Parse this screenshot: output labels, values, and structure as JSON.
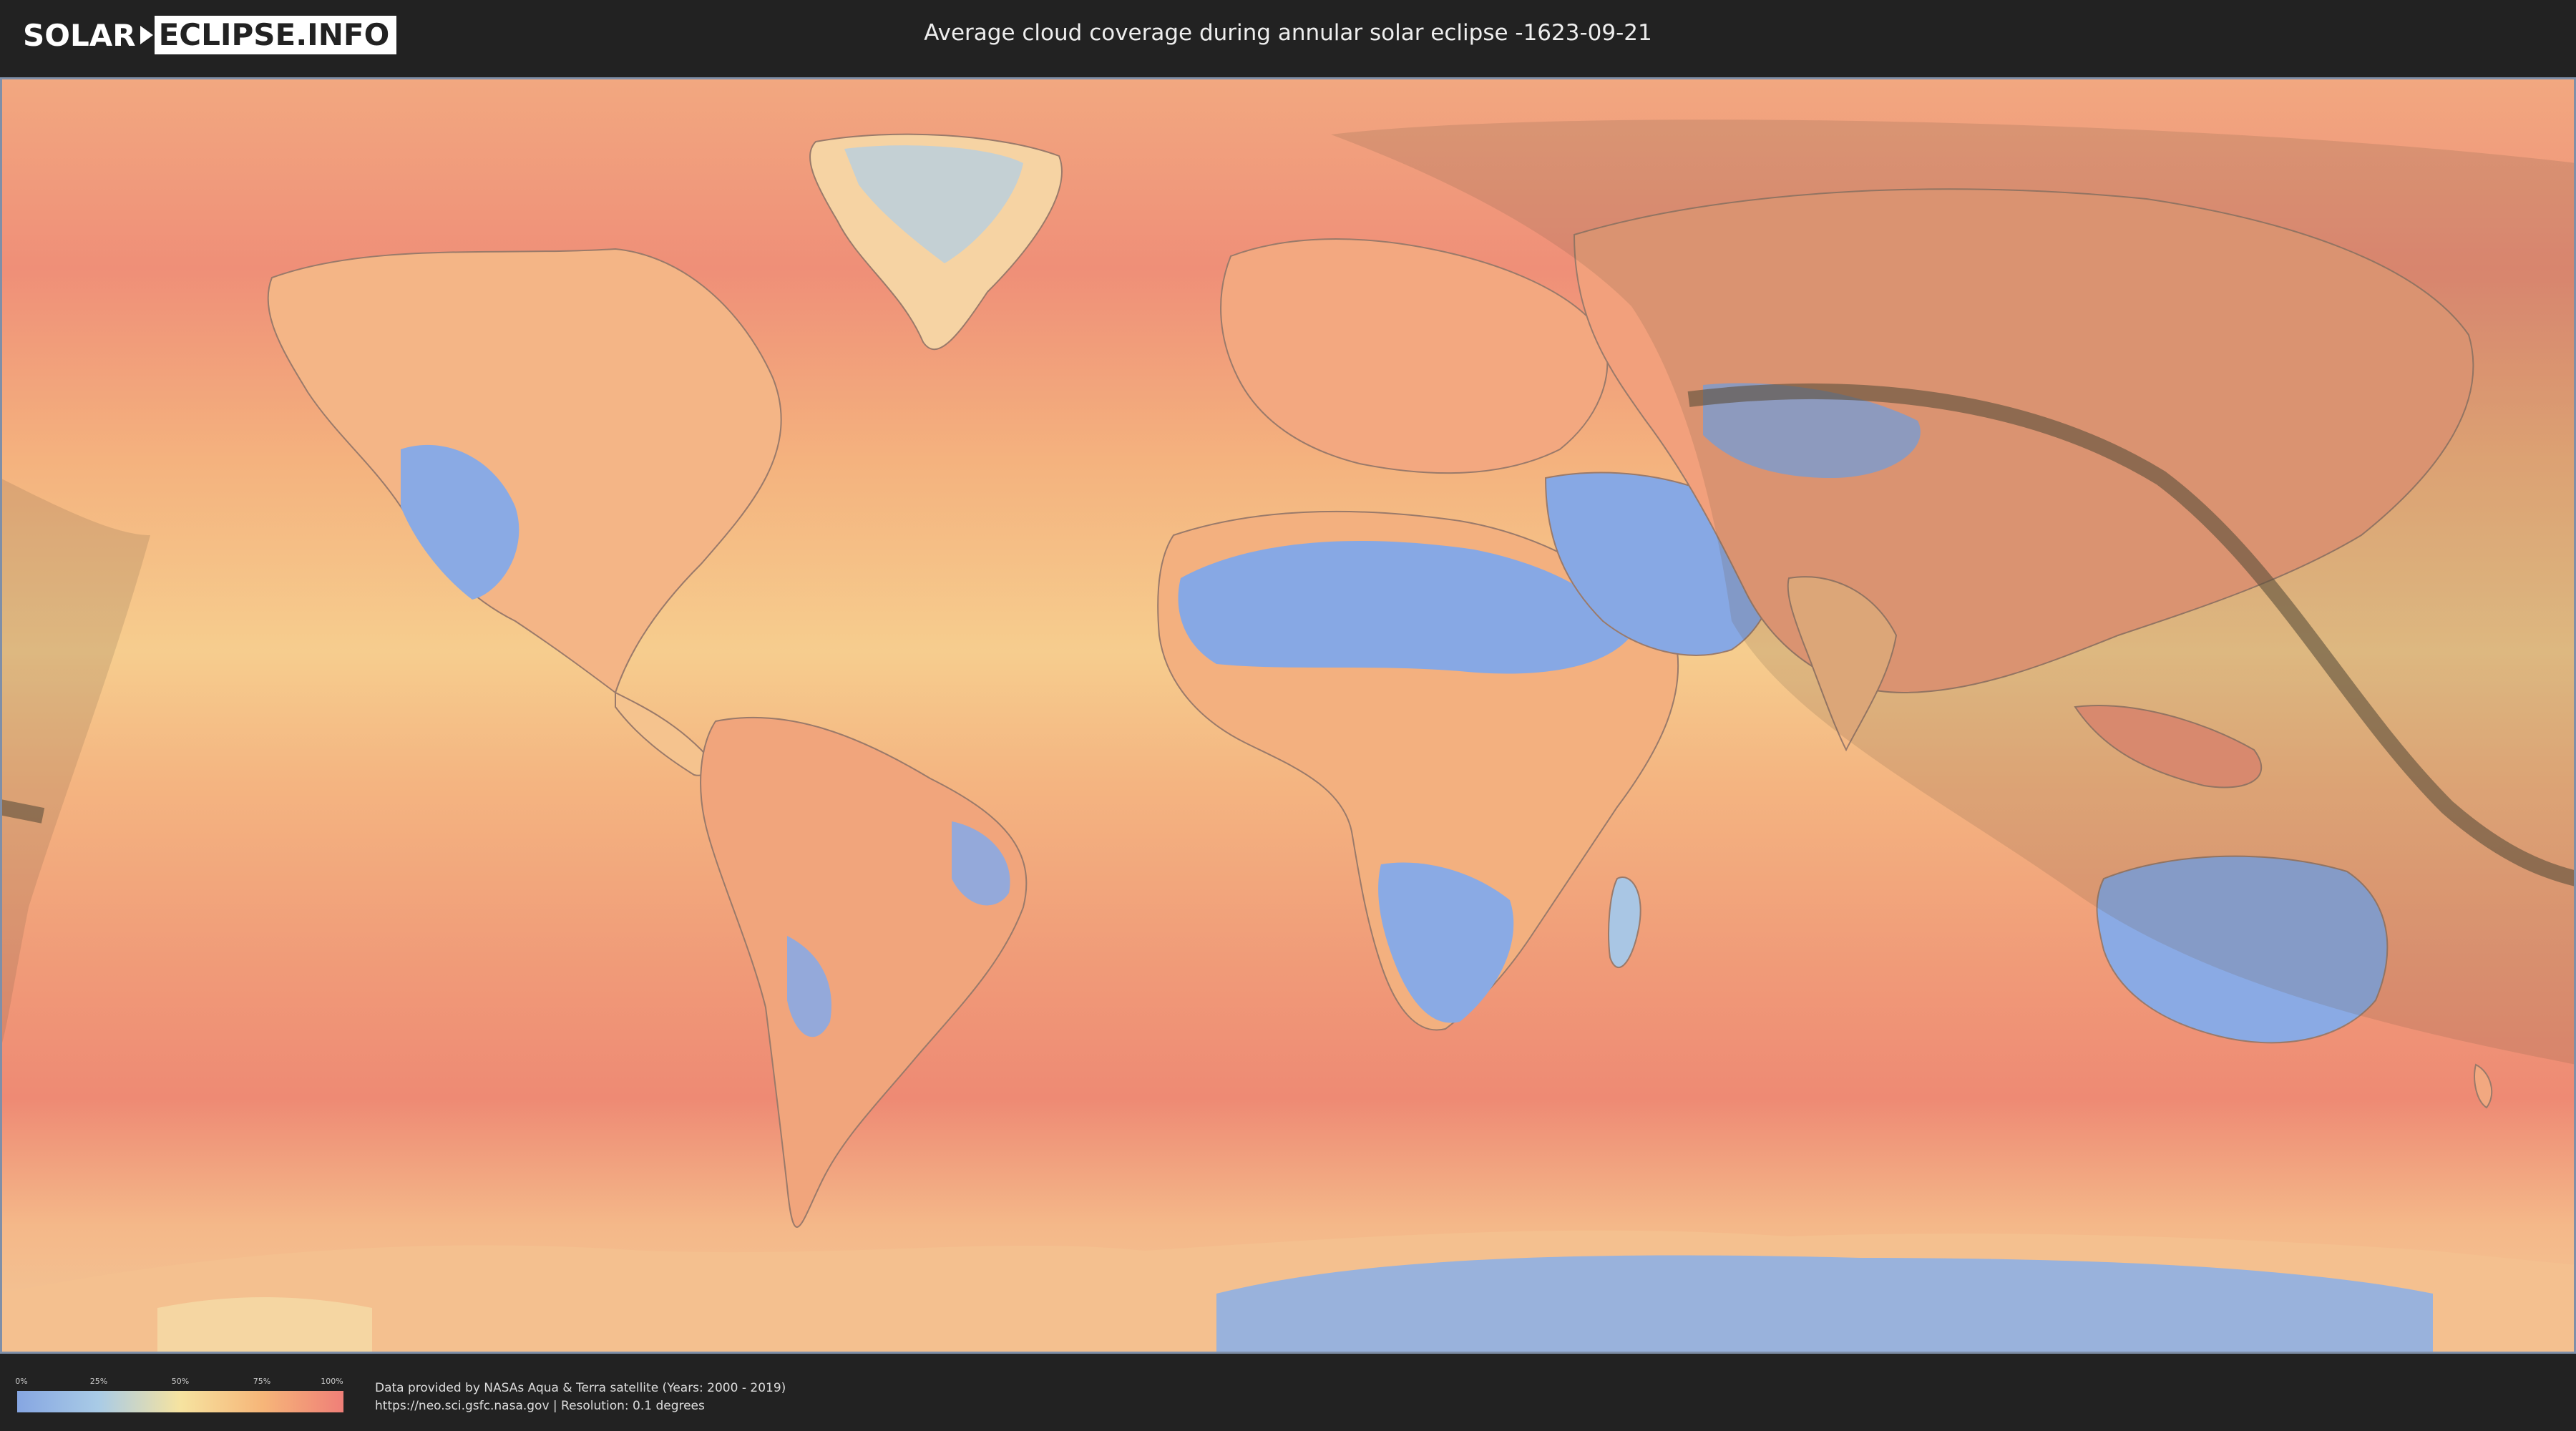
{
  "header": {
    "logo_left": "SOLAR",
    "logo_right": "ECLIPSE.INFO",
    "title": "Average cloud coverage during annular solar eclipse -1623-09-21"
  },
  "map": {
    "description_colors": {
      "ocean_cloudy": "#f0a07a",
      "very_cloudy": "#ec7f73",
      "clear": "#88a9e3",
      "mid": "#f6d79a",
      "eclipse_shade": "#7a6a55",
      "path_line": "#5b4e3a"
    }
  },
  "legend": {
    "ticks": [
      "0%",
      "25%",
      "50%",
      "75%",
      "100%"
    ],
    "colors": [
      "#86a6e2",
      "#a9cbe6",
      "#f6e3a0",
      "#f6b679",
      "#ef7f78"
    ]
  },
  "credits": {
    "line1": "Data provided by NASAs Aqua & Terra satellite (Years: 2000 - 2019)",
    "line2": "https://neo.sci.gsfc.nasa.gov | Resolution: 0.1 degrees"
  }
}
